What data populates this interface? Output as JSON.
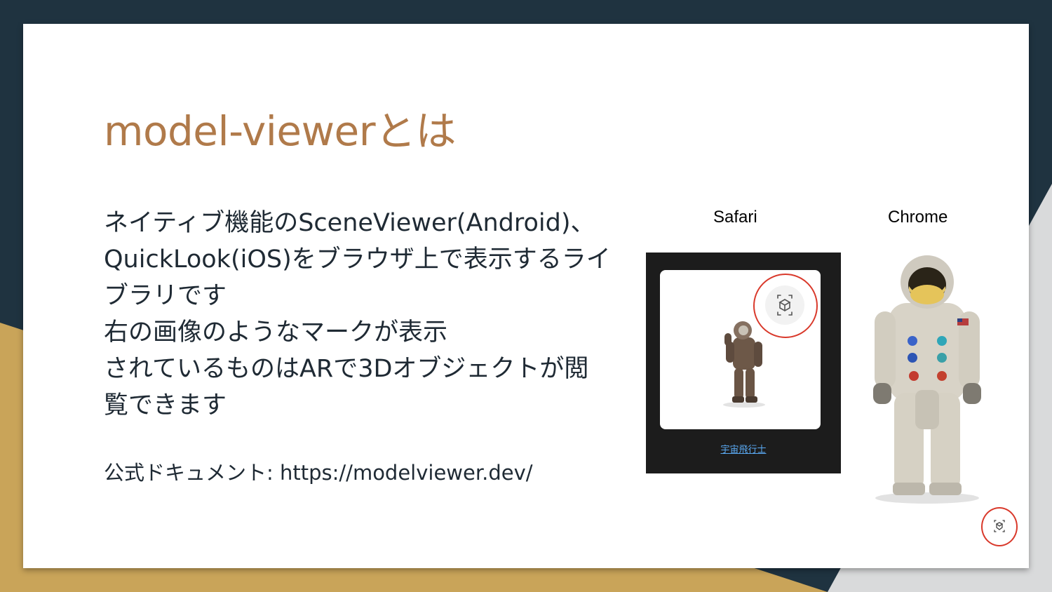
{
  "slide": {
    "title": "model-viewerとは",
    "body_lines": [
      "ネイティブ機能のSceneViewer(Android)、",
      "QuickLook(iOS)をブラウザ上で表示するライ",
      "ブラリです",
      "右の画像のようなマークが表示",
      "されているものはARで3Dオブジェクトが閲",
      "覧できます"
    ],
    "docs": "公式ドキュメント: https://modelviewer.dev/"
  },
  "figures": {
    "safari_label": "Safari",
    "chrome_label": "Chrome",
    "safari_caption": "宇宙飛行士",
    "icons": [
      "ar-view-icon",
      "astronaut-image"
    ]
  },
  "colors": {
    "title": "#b07a4a",
    "text": "#1f2a34",
    "navy": "#1f3340",
    "gold": "#c9a459",
    "annotation_red": "#d9392b",
    "link": "#5aa9f2"
  }
}
